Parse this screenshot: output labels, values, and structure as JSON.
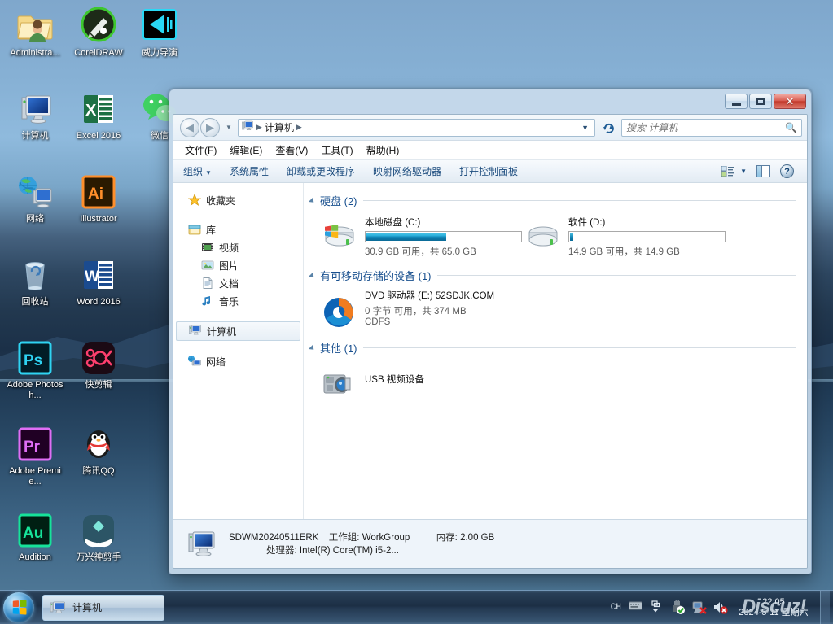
{
  "desktop": {
    "icons": [
      {
        "label": "Administra...",
        "icon": "user-folder-icon"
      },
      {
        "label": "CorelDRAW",
        "icon": "coreldraw-icon"
      },
      {
        "label": "威力导演",
        "icon": "powerdirector-icon"
      },
      {
        "label": "计算机",
        "icon": "computer-icon"
      },
      {
        "label": "Excel 2016",
        "icon": "excel-icon"
      },
      {
        "label": "微信",
        "icon": "wechat-icon"
      },
      {
        "label": "网络",
        "icon": "network-icon"
      },
      {
        "label": "Illustrator",
        "icon": "illustrator-icon"
      },
      {
        "label": "回收站",
        "icon": "recycle-bin-icon"
      },
      {
        "label": "Word 2016",
        "icon": "word-icon"
      },
      {
        "label": "Adobe Photosh...",
        "icon": "photoshop-icon"
      },
      {
        "label": "快剪辑",
        "icon": "kuaijianji-icon"
      },
      {
        "label": "Adobe Premie...",
        "icon": "premiere-icon"
      },
      {
        "label": "腾讯QQ",
        "icon": "qq-icon"
      },
      {
        "label": "Audition",
        "icon": "audition-icon"
      },
      {
        "label": "万兴神剪手",
        "icon": "wanxing-icon"
      }
    ]
  },
  "window": {
    "title": "计算机",
    "controls": {
      "minimize": "minimize-button",
      "maximize": "maximize-button",
      "close": "close-button"
    },
    "address": {
      "root_icon": "computer-icon",
      "crumbs": [
        "计算机"
      ],
      "dropdown_caret": "▼"
    },
    "search": {
      "placeholder": "搜索 计算机",
      "value": ""
    },
    "menubar": [
      "文件(F)",
      "编辑(E)",
      "查看(V)",
      "工具(T)",
      "帮助(H)"
    ],
    "commandbar": {
      "organize": "组织",
      "items": [
        "系统属性",
        "卸载或更改程序",
        "映射网络驱动器",
        "打开控制面板"
      ],
      "view_icon": "view-options-icon",
      "preview_icon": "preview-pane-icon",
      "help_icon": "help-icon"
    }
  },
  "navpane": {
    "sections": [
      {
        "label": "收藏夹",
        "icon": "favorites-star-icon",
        "level": 0,
        "selected": false
      },
      {
        "label": "库",
        "icon": "library-icon",
        "level": 0,
        "selected": false
      },
      {
        "label": "视频",
        "icon": "video-icon",
        "level": 1,
        "selected": false
      },
      {
        "label": "图片",
        "icon": "pictures-icon",
        "level": 1,
        "selected": false
      },
      {
        "label": "文档",
        "icon": "documents-icon",
        "level": 1,
        "selected": false
      },
      {
        "label": "音乐",
        "icon": "music-icon",
        "level": 1,
        "selected": false
      },
      {
        "label": "计算机",
        "icon": "computer-icon",
        "level": 0,
        "selected": true
      },
      {
        "label": "网络",
        "icon": "network-icon",
        "level": 0,
        "selected": false
      }
    ]
  },
  "content": {
    "groups": [
      {
        "title": "硬盘 (2)",
        "items": [
          {
            "name": "本地磁盘 (C:)",
            "icon": "hard-drive-system-icon",
            "bar": true,
            "used_percent": 52,
            "free_total": "30.9 GB 可用，共 65.0 GB",
            "extra": ""
          },
          {
            "name": "软件 (D:)",
            "icon": "hard-drive-icon",
            "bar": true,
            "used_percent": 2,
            "free_total": "14.9 GB 可用，共 14.9 GB",
            "extra": ""
          }
        ]
      },
      {
        "title": "有可移动存储的设备 (1)",
        "items": [
          {
            "name": "DVD 驱动器 (E:) 52SDJK.COM",
            "icon": "dvd-drive-icon",
            "bar": false,
            "used_percent": 0,
            "free_total": "0 字节 可用，共 374 MB",
            "extra": "CDFS"
          }
        ]
      },
      {
        "title": "其他 (1)",
        "items": [
          {
            "name": "USB 视频设备",
            "icon": "usb-camera-icon",
            "bar": false,
            "used_percent": 0,
            "free_total": "",
            "extra": ""
          }
        ]
      }
    ]
  },
  "details": {
    "icon": "computer-icon",
    "computer_name": "SDWM20240511ERK",
    "workgroup_label": "工作组:",
    "workgroup_value": "WorkGroup",
    "memory_label": "内存:",
    "memory_value": "2.00 GB",
    "processor_label": "处理器:",
    "processor_value": "Intel(R) Core(TM) i5-2..."
  },
  "taskbar": {
    "start": "start-orb",
    "tasks": [
      {
        "label": "计算机",
        "icon": "computer-icon",
        "active": true
      }
    ],
    "tray": {
      "ime": "CH",
      "icons": [
        "keyboard-icon",
        "show-hidden-icon",
        "usb-safely-remove-icon",
        "network-error-icon",
        "volume-muted-icon"
      ],
      "clock_time": "22:05",
      "clock_date": "2024-5-11 星期六",
      "watermark": "Discuz!"
    }
  },
  "colors": {
    "accent": "#1b4b7d",
    "group_title": "#19508f",
    "bar_blue": "#0d7fb0",
    "close_red": "#c23a2c"
  }
}
